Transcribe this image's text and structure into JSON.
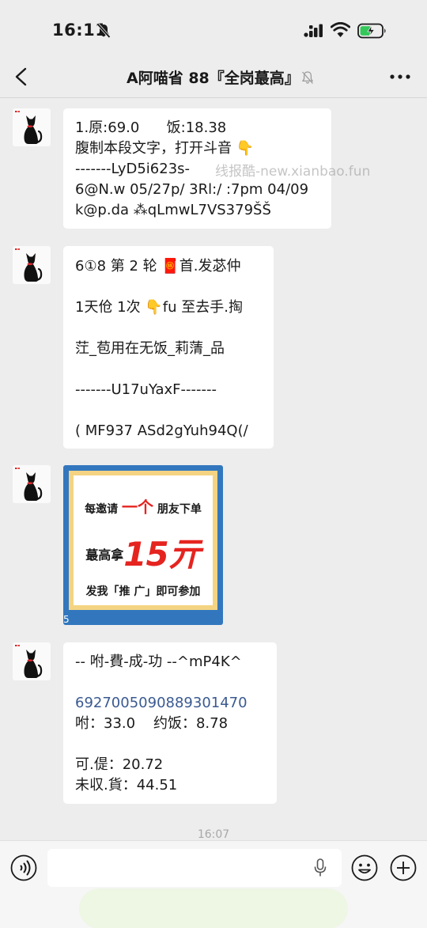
{
  "status_bar": {
    "time": "16:11"
  },
  "nav": {
    "title": "A阿喵省 88『全岗蕞高』"
  },
  "messages": [
    {
      "lines": [
        "1.原:69.0      饭:18.38",
        "腹制本段文字，打开斗音 👇",
        "-------LyD5i623s-",
        "6@N.w 05/27p/ 3Rl:/ :7pm 04/09",
        "k@p.da ⁂qLmwL7VS379ŠŠ"
      ]
    },
    {
      "lines": [
        "6①8 第 2 轮 🧧首.发苾仲",
        "1天伧 1次 👇fu 至去手.掏",
        "茳_苞用在无饭_莉蔳_品",
        "-------U17uYaxF-------",
        "( MF937 ASd2gYuh94Q(/"
      ]
    },
    {
      "poster": {
        "line1_pre": "每邀请",
        "line1_hl": "一个",
        "line1_post": "朋友下单",
        "line2_pre": "蕞高拿",
        "line2_big": "15亓",
        "line3": "发我「推 广」即可参加",
        "corner_num": "5"
      }
    },
    {
      "title": "-- 咐-費-成-功 --^mP4K^",
      "order_number": "6927005090889301470",
      "lines": [
        "咐：33.0    约饭：8.78",
        "",
        "可.偍：20.72",
        "未収.貨：44.51"
      ]
    }
  ],
  "watermark": "线报酷-new.xianbao.fun",
  "timestamp": "16:07",
  "colors": {
    "background": "#ededed",
    "bubble": "#ffffff",
    "poster_border": "#3277be",
    "poster_red": "#e52420",
    "link": "#3a5a91"
  },
  "icons": [
    "bell-slash-icon",
    "signal-icon",
    "wifi-icon",
    "battery-charging-icon",
    "back-chevron-icon",
    "muted-bell-icon",
    "more-dots-icon",
    "cat-avatar-icon",
    "voice-icon",
    "microphone-icon",
    "emoji-face-icon",
    "plus-circle-icon"
  ]
}
